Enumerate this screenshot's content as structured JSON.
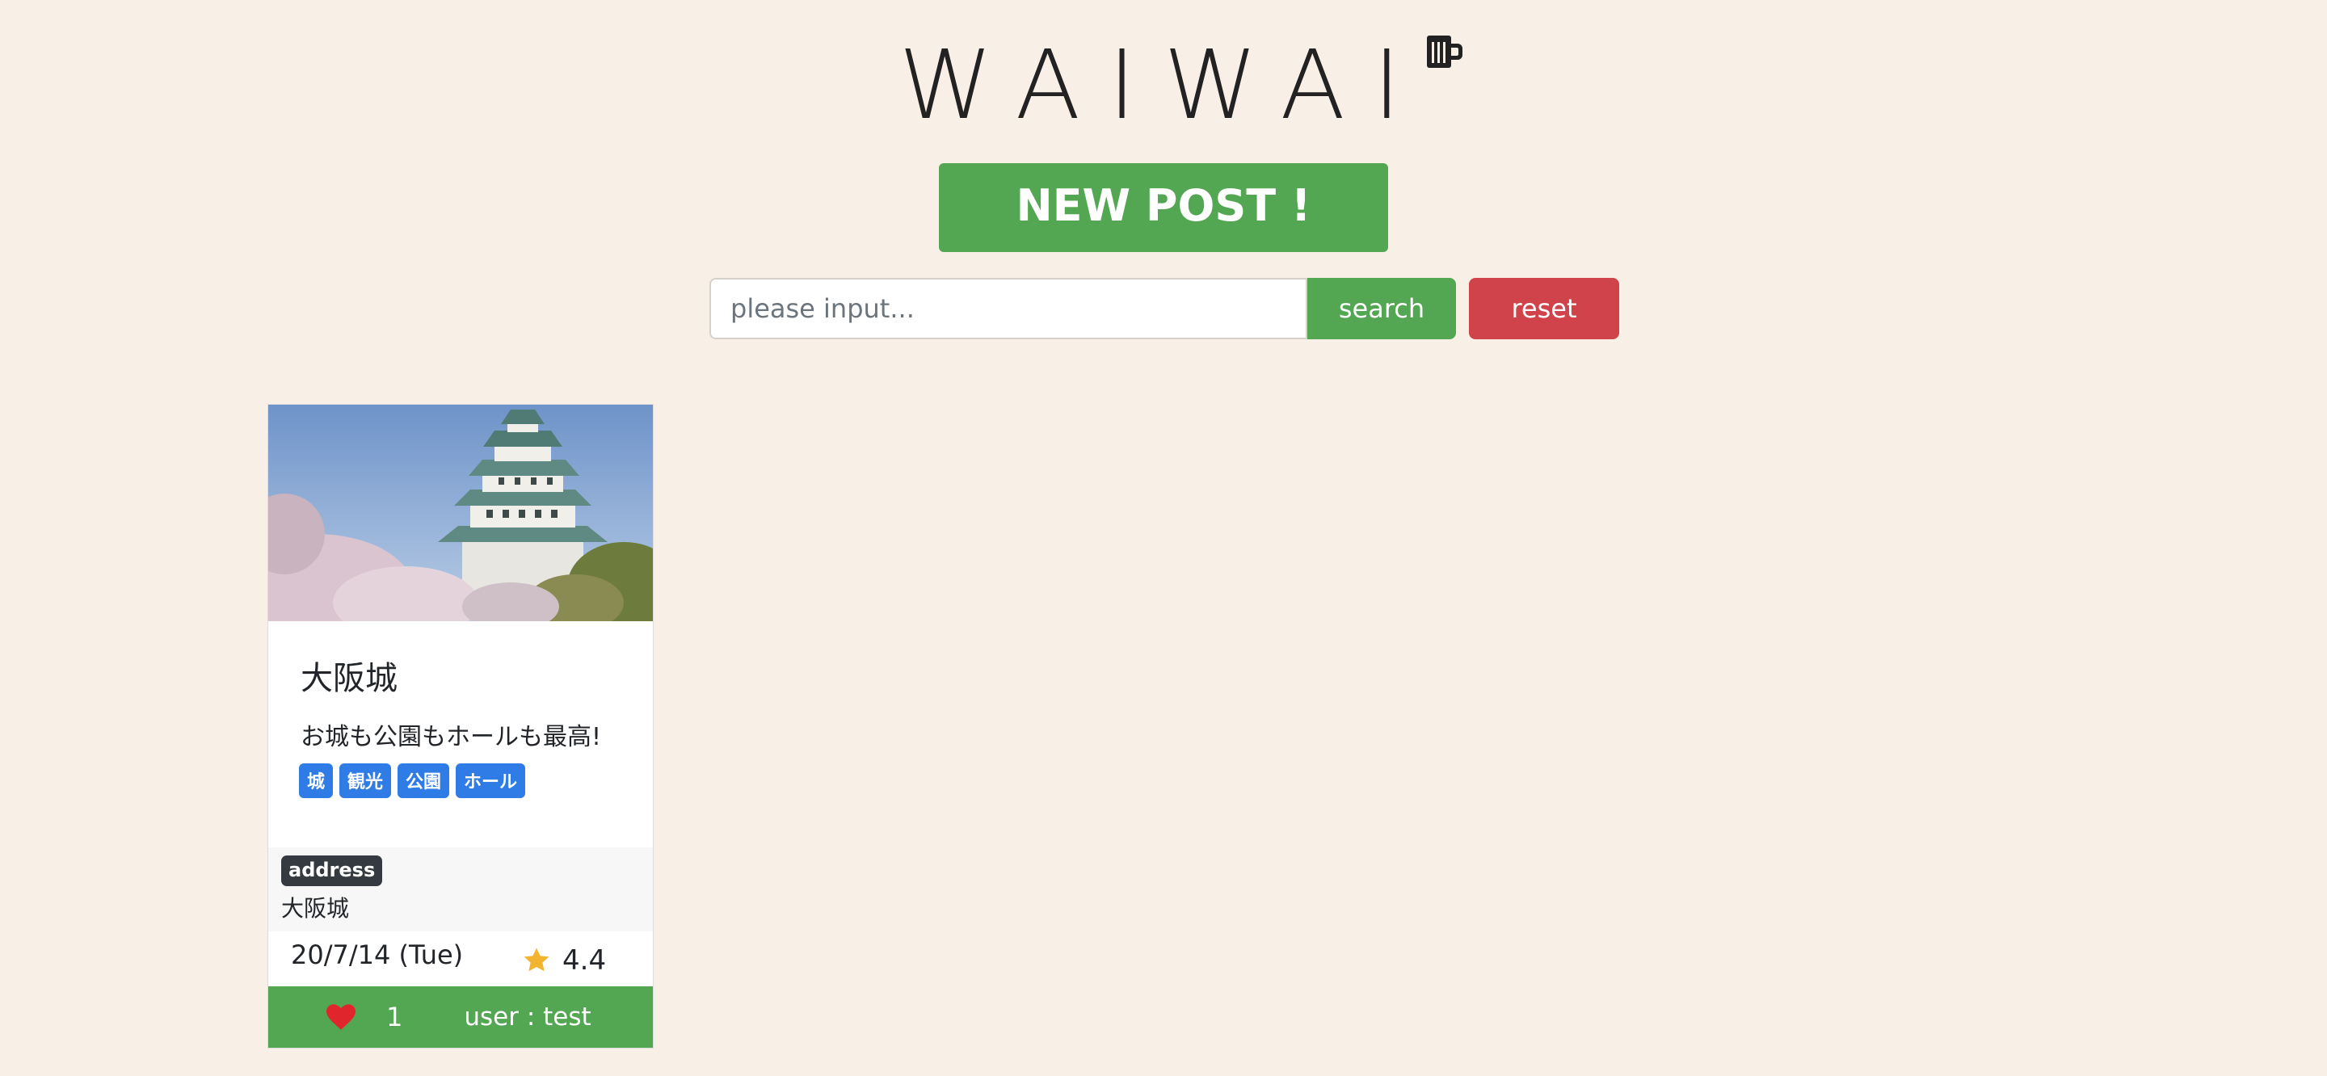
{
  "header": {
    "logo": "WAIWAI",
    "logo_icon": "beer-mug-icon"
  },
  "actions": {
    "new_post_label": "NEW POST !"
  },
  "search": {
    "placeholder": "please input...",
    "value": "",
    "search_label": "search",
    "reset_label": "reset"
  },
  "colors": {
    "background": "#f8efe6",
    "primary_green": "#54a752",
    "danger_red": "#d0434a",
    "tag_blue": "#2f7ce6",
    "badge_dark": "#343a40",
    "star": "#f3b52f",
    "heart": "#e0262c"
  },
  "posts": [
    {
      "image": "osaka-castle-photo",
      "title": "大阪城",
      "text": "お城も公園もホールも最高!",
      "tags": [
        "城",
        "観光",
        "公園",
        "ホール"
      ],
      "address_label": "address",
      "address": "大阪城",
      "date": "20/7/14 (Tue)",
      "rating": "4.4",
      "likes": "1",
      "user": "user : test"
    }
  ]
}
